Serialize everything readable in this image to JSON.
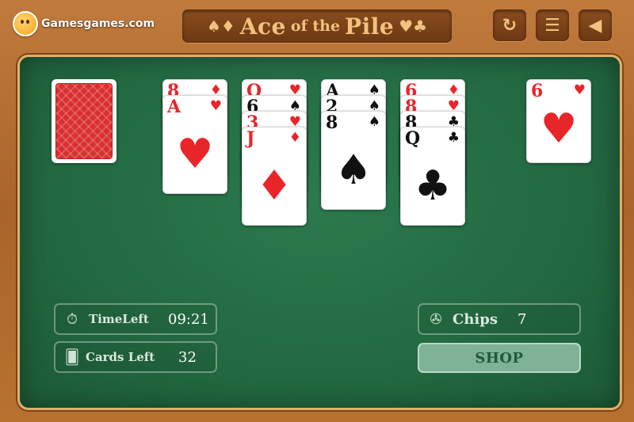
{
  "header": {
    "logo_text": "Gamesgames.com",
    "title_suits_left": "♠♦",
    "title_part1": "Ace",
    "title_part2": "of the",
    "title_part3": "Pile",
    "title_suits_right": "♥♣",
    "buttons": [
      {
        "name": "restart",
        "icon": "restart-icon",
        "glyph": "↻"
      },
      {
        "name": "menu",
        "icon": "menu-icon",
        "glyph": "☰"
      },
      {
        "name": "sound",
        "icon": "sound-icon",
        "glyph": "◀"
      }
    ]
  },
  "colors": {
    "felt": "#236a42",
    "red_suit": "#e8262a",
    "black_suit": "#111111",
    "title_gold": "#f2c27e"
  },
  "piles": [
    {
      "cards": [
        {
          "rank": "8",
          "suit": "♦",
          "color": "red"
        },
        {
          "rank": "A",
          "suit": "♥",
          "color": "red"
        }
      ]
    },
    {
      "cards": [
        {
          "rank": "Q",
          "suit": "♥",
          "color": "red"
        },
        {
          "rank": "6",
          "suit": "♠",
          "color": "black"
        },
        {
          "rank": "3",
          "suit": "♥",
          "color": "red"
        },
        {
          "rank": "J",
          "suit": "♦",
          "color": "red"
        }
      ]
    },
    {
      "cards": [
        {
          "rank": "A",
          "suit": "♠",
          "color": "black"
        },
        {
          "rank": "2",
          "suit": "♠",
          "color": "black"
        },
        {
          "rank": "8",
          "suit": "♠",
          "color": "black"
        }
      ]
    },
    {
      "cards": [
        {
          "rank": "6",
          "suit": "♦",
          "color": "red"
        },
        {
          "rank": "8",
          "suit": "♥",
          "color": "red"
        },
        {
          "rank": "8",
          "suit": "♣",
          "color": "black"
        },
        {
          "rank": "Q",
          "suit": "♣",
          "color": "black"
        }
      ]
    }
  ],
  "discard": {
    "rank": "6",
    "suit": "♥",
    "color": "red"
  },
  "stats": {
    "time_label": "TimeLeft",
    "time_value": "09:21",
    "cards_label": "Cards Left",
    "cards_value": "32",
    "chips_label": "Chips",
    "chips_value": "7",
    "shop_label": "SHOP"
  }
}
